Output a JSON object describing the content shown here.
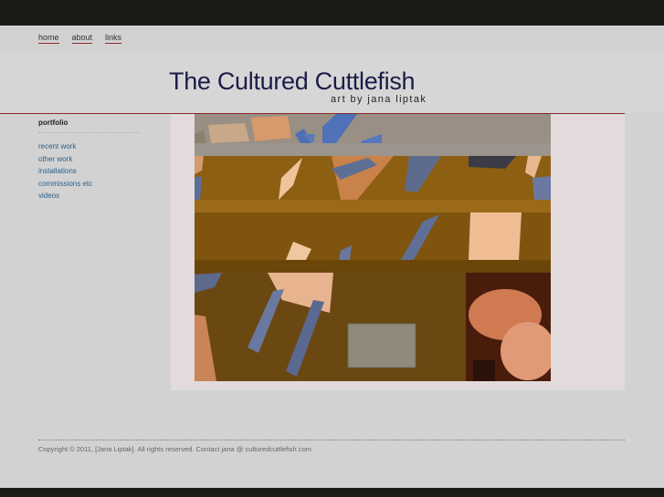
{
  "nav": {
    "items": [
      {
        "label": "home"
      },
      {
        "label": "about"
      },
      {
        "label": "links"
      }
    ]
  },
  "header": {
    "title": "The Cultured Cuttlefish",
    "subtitle": "art by jana liptak"
  },
  "sidebar": {
    "heading": "portfolio",
    "items": [
      {
        "label": "recent work"
      },
      {
        "label": "other work"
      },
      {
        "label": "installations"
      },
      {
        "label": "commissions etc"
      },
      {
        "label": "videos"
      }
    ]
  },
  "artwork": {
    "alt": "",
    "colors": {
      "wood": "#8a5c12",
      "wood_dark": "#5e3e0c",
      "copper": "#d9925e",
      "slate_blue": "#5a6e9c",
      "band": "#a08a6e"
    }
  },
  "footer": {
    "copyright": "Copyright © 2011, [Jana Liptak]. All rights reserved. Contact jana @ culturedcuttlefish.com"
  }
}
